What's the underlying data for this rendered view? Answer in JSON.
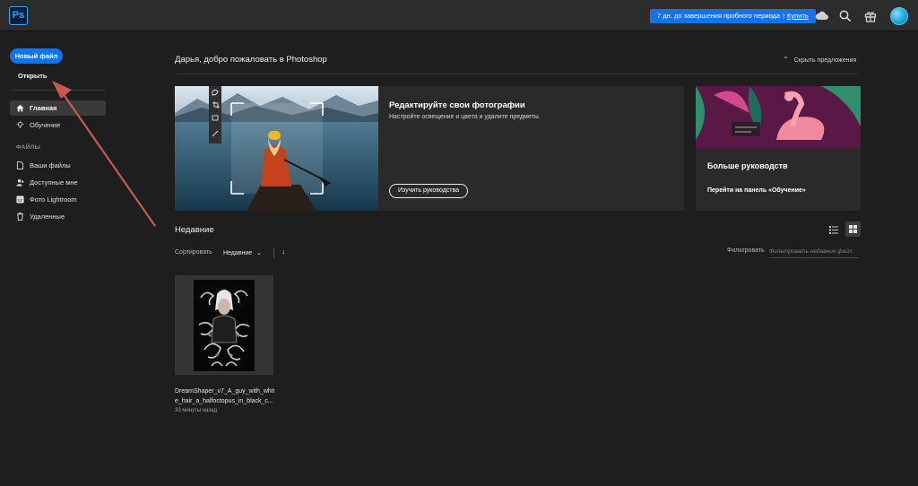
{
  "app": {
    "logo_text": "Ps",
    "brand_color": "#31a8ff",
    "accent": "#1473e6"
  },
  "topbar": {
    "trial_text": "7 дн. до завершения пробного периода",
    "separator": "|",
    "buy_label": "Купить",
    "icons": [
      "cloud-icon",
      "search-icon",
      "gift-icon",
      "avatar"
    ]
  },
  "sidebar": {
    "new_file": "Новый файл",
    "open": "Открыть",
    "nav": [
      {
        "label": "Главная",
        "icon": "home-icon",
        "active": true
      },
      {
        "label": "Обучение",
        "icon": "lightbulb-icon",
        "active": false
      }
    ],
    "files_section": "ФАЙЛЫ",
    "files": [
      {
        "label": "Ваши файлы",
        "icon": "file-icon"
      },
      {
        "label": "Доступные мне",
        "icon": "shared-user-icon"
      },
      {
        "label": "Фото Lightroom",
        "icon": "lightroom-icon"
      },
      {
        "label": "Удаленные",
        "icon": "trash-icon"
      }
    ]
  },
  "main": {
    "welcome": "Дарья, добро пожаловать в Photoshop",
    "hide_suggestions": "Скрыть предложения",
    "hero": {
      "title": "Редактируйте свои фотографии",
      "subtitle": "Настройте освещение и цвета и удалите предметы.",
      "button": "Изучить руководства"
    },
    "more": {
      "title": "Больше руководств",
      "link": "Перейти на панель «Обучение»"
    },
    "recent": {
      "title": "Недавние",
      "sort_label": "Сортировать",
      "sort_value": "Недавние",
      "filter_label": "Фильтровать",
      "filter_placeholder": "Фильтровать недавние файл.",
      "files": [
        {
          "name": "DreamShaper_v7_A_guy_with_white_hair_a_halfoctopus_in_black_c...",
          "time": "33 минуты назад"
        }
      ]
    }
  }
}
